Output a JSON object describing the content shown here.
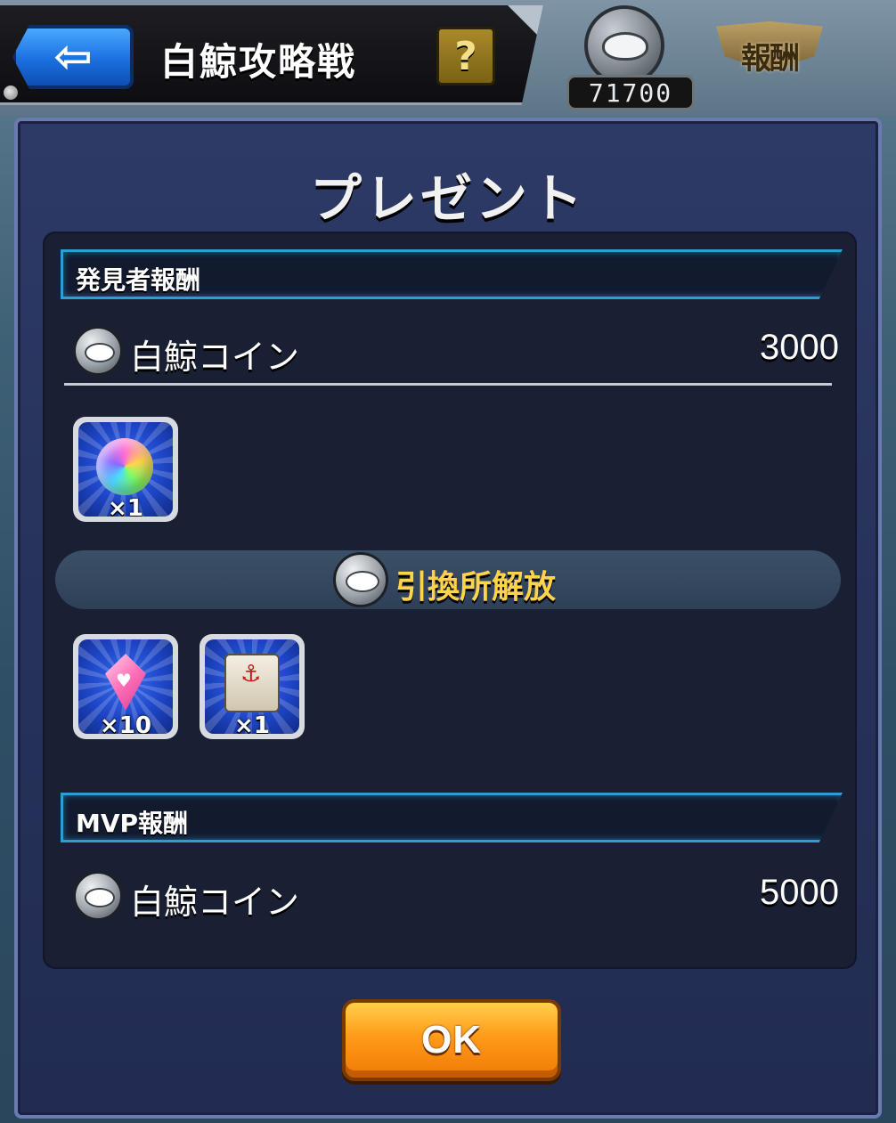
{
  "header": {
    "title": "白鯨攻略戦",
    "help_label": "?",
    "coin_count": "71700",
    "reward_label": "報酬"
  },
  "dialog": {
    "title": "プレゼント",
    "discoverer_section": {
      "heading": "発見者報酬",
      "coin_name": "白鯨コイン",
      "coin_amount": "3000",
      "items": [
        {
          "name": "orb-icon",
          "qty": "×1"
        }
      ],
      "unlock_label": "引換所解放",
      "unlock_items": [
        {
          "name": "gem-icon",
          "qty": "×10"
        },
        {
          "name": "scroll-icon",
          "qty": "×1"
        }
      ]
    },
    "mvp_section": {
      "heading": "MVP報酬",
      "coin_name": "白鯨コイン",
      "coin_amount": "5000"
    },
    "ok_label": "OK"
  }
}
